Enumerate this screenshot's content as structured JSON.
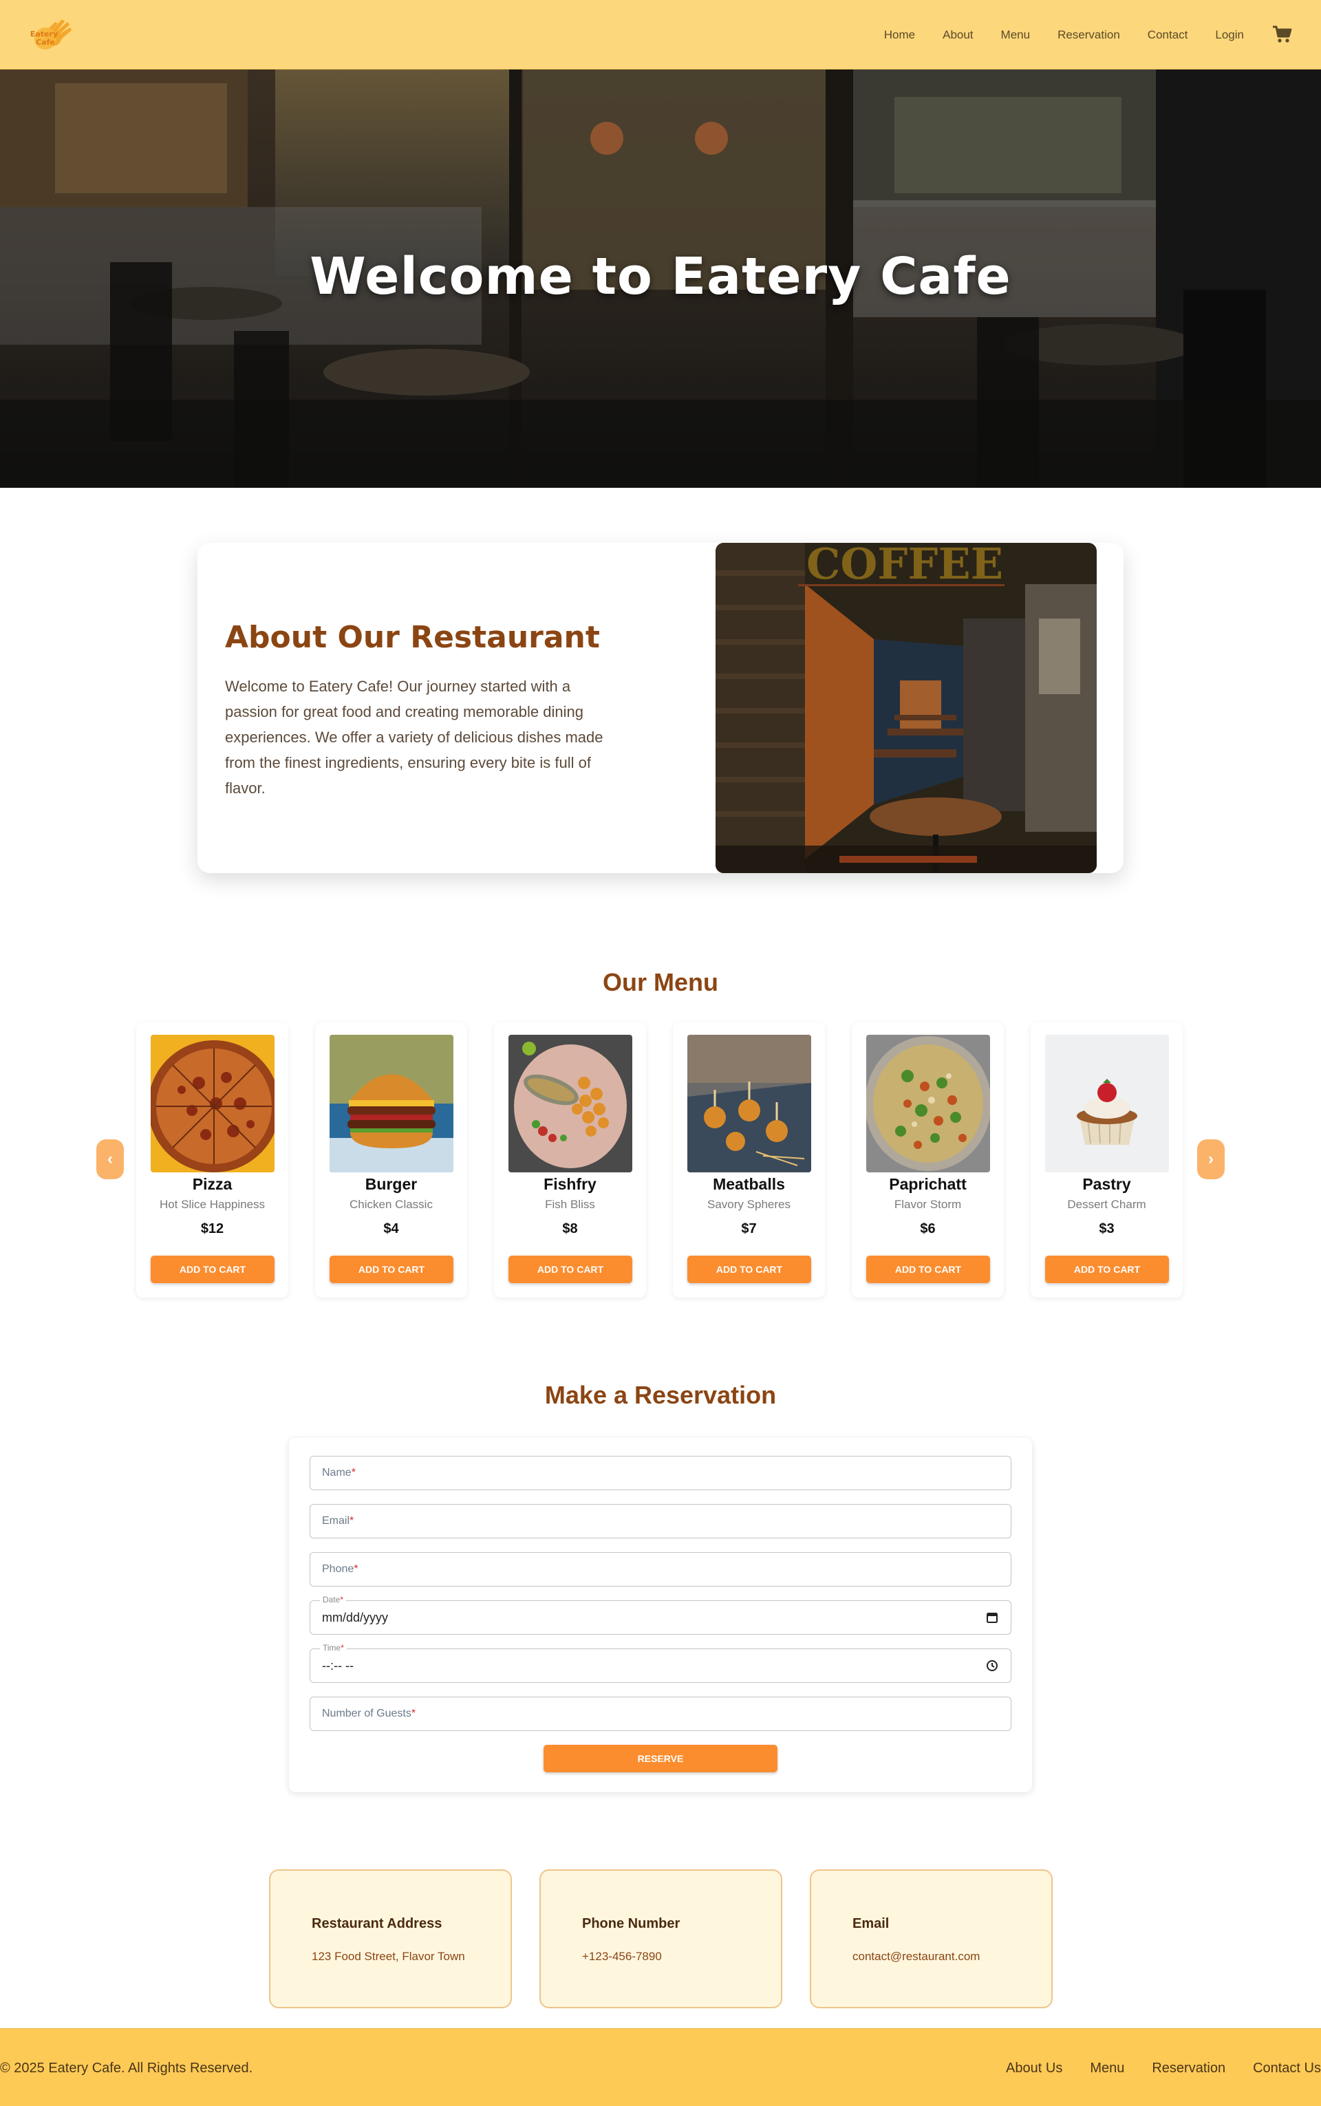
{
  "brand": {
    "logo_text": "Eatery Cafe"
  },
  "nav": {
    "links": [
      "Home",
      "About",
      "Menu",
      "Reservation",
      "Contact",
      "Login"
    ],
    "cart_icon": "shopping-cart-icon"
  },
  "hero": {
    "title": "Welcome to Eatery Cafe"
  },
  "about": {
    "title": "About Our Restaurant",
    "text": "Welcome to Eatery Cafe! Our journey started with a passion for great food and creating memorable dining experiences. We offer a variety of delicious dishes made from the finest ingredients, ensuring every bite is full of flavor.",
    "image_sign": "COFFEE"
  },
  "menu": {
    "title": "Our Menu",
    "prev_label": "‹",
    "next_label": "›",
    "add_label": "ADD TO CART",
    "items": [
      {
        "name": "Pizza",
        "desc": "Hot Slice Happiness",
        "price": "$12"
      },
      {
        "name": "Burger",
        "desc": "Chicken Classic",
        "price": "$4"
      },
      {
        "name": "Fishfry",
        "desc": "Fish Bliss",
        "price": "$8"
      },
      {
        "name": "Meatballs",
        "desc": "Savory Spheres",
        "price": "$7"
      },
      {
        "name": "Paprichatt",
        "desc": "Flavor Storm",
        "price": "$6"
      },
      {
        "name": "Pastry",
        "desc": "Dessert Charm",
        "price": "$3"
      }
    ]
  },
  "reservation": {
    "title": "Make a Reservation",
    "name_label": "Name",
    "email_label": "Email",
    "phone_label": "Phone",
    "date_label": "Date",
    "date_value": "mm/dd/yyyy",
    "time_label": "Time",
    "time_value": "--:-- --",
    "guests_label": "Number of Guests",
    "required_mark": "*",
    "submit_label": "RESERVE"
  },
  "contact": {
    "address_title": "Restaurant Address",
    "address_value": "123 Food Street, Flavor Town",
    "phone_title": "Phone Number",
    "phone_value": "+123-456-7890",
    "email_title": "Email",
    "email_value": "contact@restaurant.com"
  },
  "footer": {
    "copyright": "© 2025 Eatery Cafe. All Rights Reserved.",
    "links": [
      "About Us",
      "Menu",
      "Reservation",
      "Contact Us"
    ]
  },
  "colors": {
    "nav_bg": "#fdd77c",
    "footer_bg": "#fdca56",
    "accent": "#fb8d2f",
    "heading_brown": "#8b4513",
    "card_cream": "#fff6de"
  }
}
